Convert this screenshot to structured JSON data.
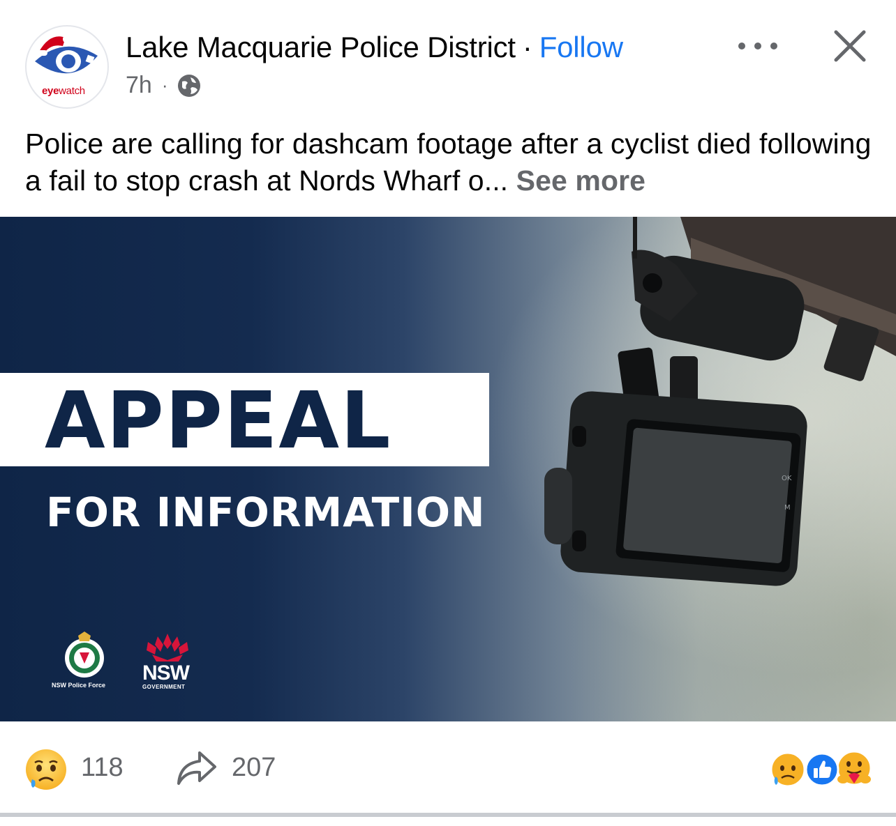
{
  "post": {
    "page_name": "Lake Macquarie Police District",
    "separator": "·",
    "follow_label": "Follow",
    "time": "7h",
    "meta_separator": "·",
    "avatar_brand_a": "eye",
    "avatar_brand_b": "watch",
    "caption_text": "Police are calling for dashcam footage after a cyclist died following a fail to stop crash at Nords Wharf o...",
    "see_more_label": "See more"
  },
  "image": {
    "headline": "APPEAL",
    "subheadline": "FOR INFORMATION",
    "police_logo_label": "NSW Police Force",
    "nsw_label": "NSW",
    "nsw_sub": "GOVERNMENT",
    "camera_labels": [
      "OK",
      "M"
    ]
  },
  "footer": {
    "reaction_count": "118",
    "share_count": "207"
  },
  "icons": {
    "more": "more-options-icon",
    "close": "close-icon",
    "globe": "globe-icon",
    "share": "share-arrow-icon",
    "sad": "sad-reaction-icon",
    "like": "like-reaction-icon",
    "care": "care-reaction-icon"
  },
  "colors": {
    "accent": "#1877f2",
    "secondary_text": "#65676b",
    "navy": "#0f2547",
    "nsw_red": "#d7153a"
  }
}
